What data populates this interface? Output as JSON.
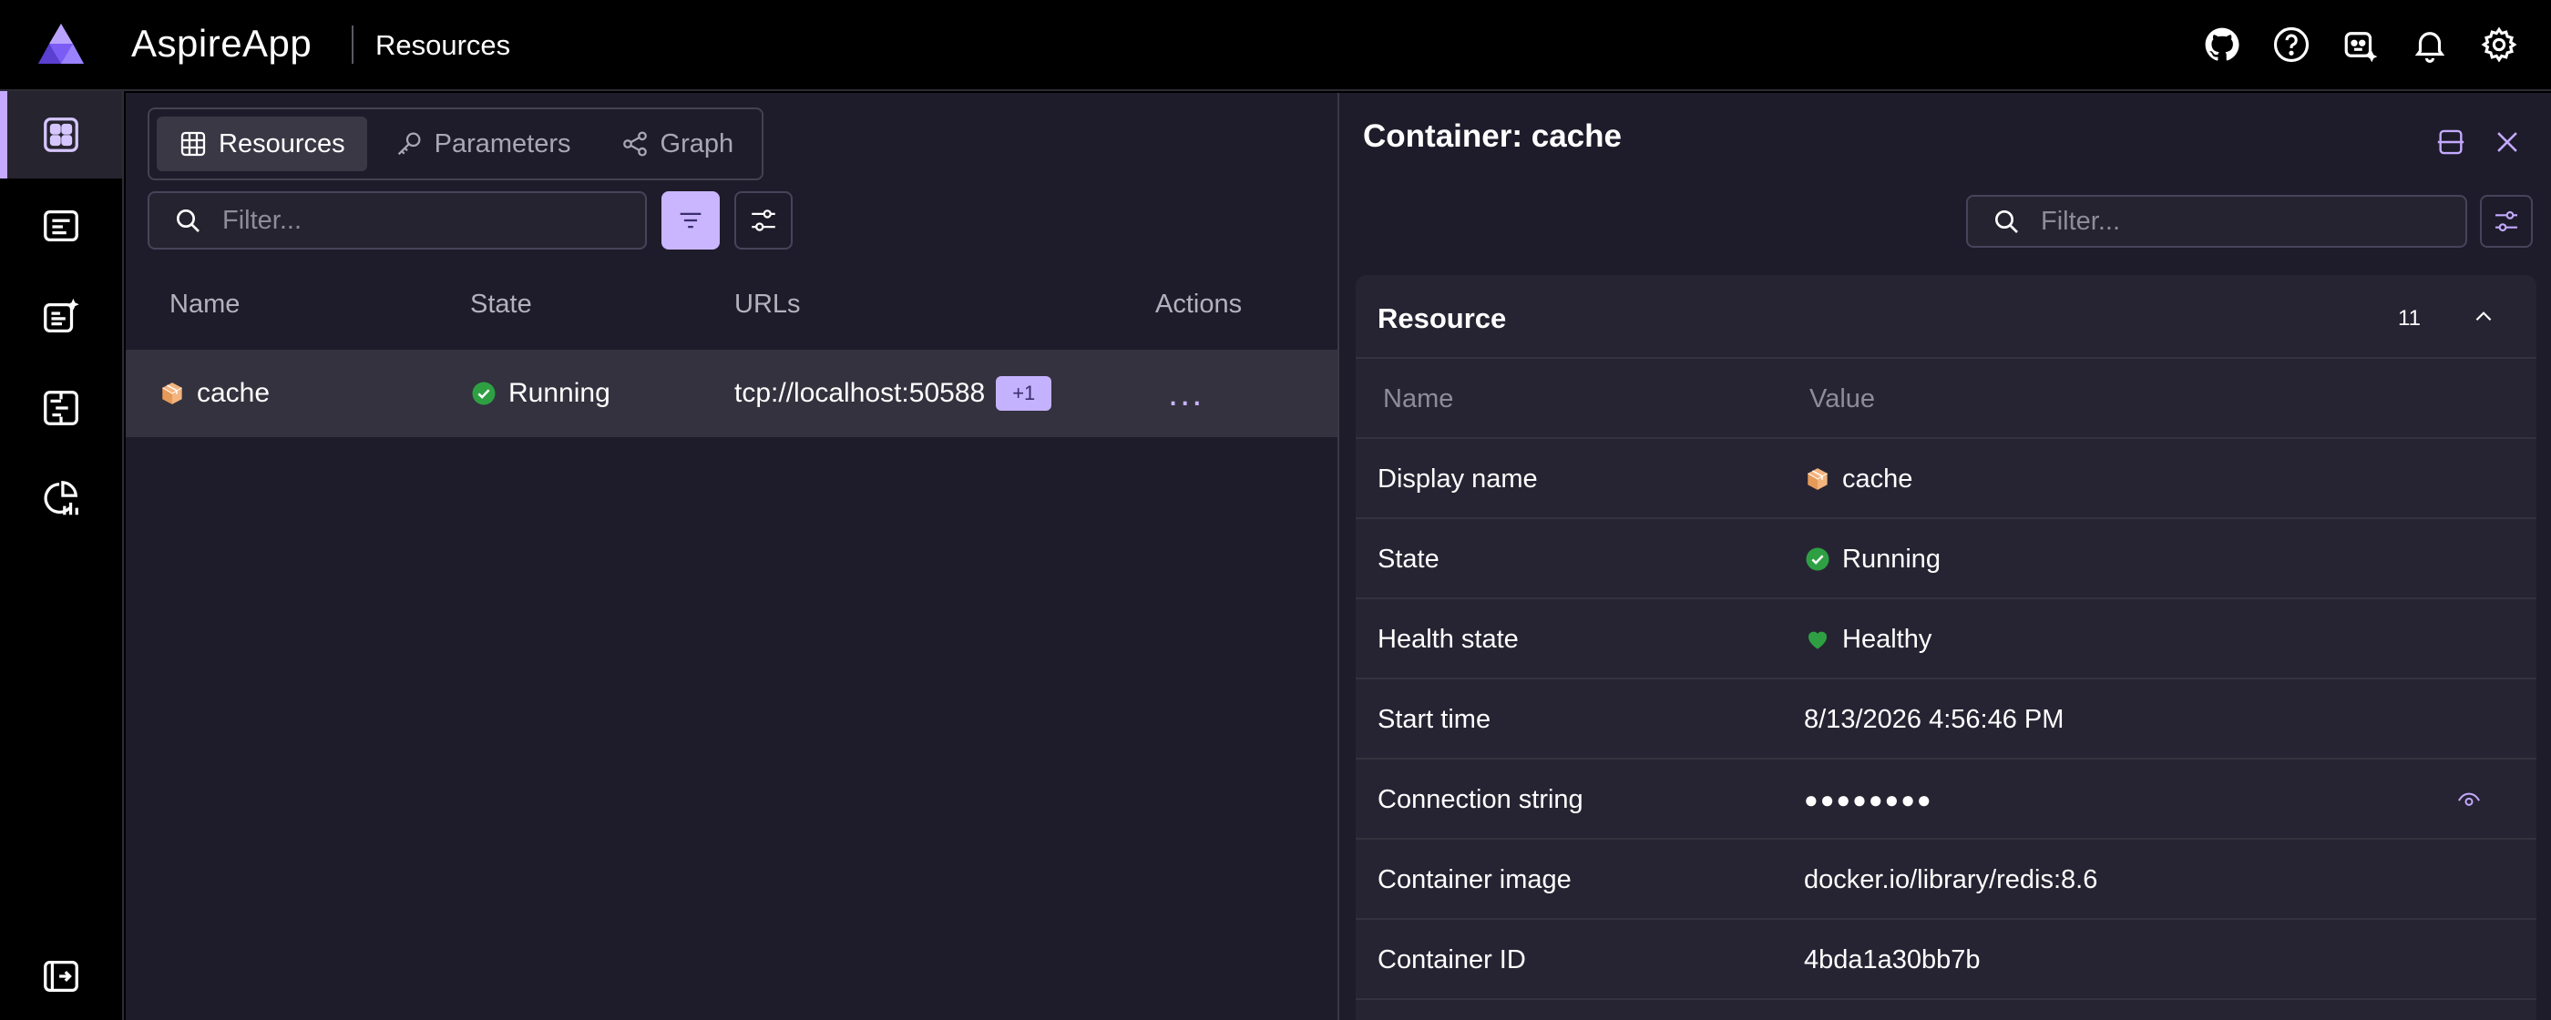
{
  "app": {
    "name": "AspireApp",
    "page_title": "Resources"
  },
  "top_icons": [
    "github-icon",
    "help-icon",
    "copilot-icon",
    "notification-bell-icon",
    "settings-gear-icon"
  ],
  "nav": {
    "items": [
      {
        "name": "resources",
        "active": true
      },
      {
        "name": "console-logs",
        "active": false
      },
      {
        "name": "structured-logs",
        "active": false
      },
      {
        "name": "traces",
        "active": false
      },
      {
        "name": "metrics",
        "active": false
      }
    ]
  },
  "tabs": [
    {
      "label": "Resources",
      "active": true
    },
    {
      "label": "Parameters",
      "active": false
    },
    {
      "label": "Graph",
      "active": false
    }
  ],
  "filter": {
    "placeholder": "Filter..."
  },
  "grid": {
    "headers": {
      "name": "Name",
      "state": "State",
      "urls": "URLs",
      "actions": "Actions"
    },
    "rows": [
      {
        "name": "cache",
        "state": "Running",
        "url": "tcp://localhost:50588",
        "url_extra": "+1",
        "actions": "..."
      }
    ]
  },
  "details": {
    "title": "Container: cache",
    "filter_placeholder": "Filter...",
    "section": {
      "title": "Resource",
      "count": "11",
      "col_name": "Name",
      "col_value": "Value",
      "rows": [
        {
          "name": "Display name",
          "value": "cache"
        },
        {
          "name": "State",
          "value": "Running"
        },
        {
          "name": "Health state",
          "value": "Healthy"
        },
        {
          "name": "Start time",
          "value": "8/13/2026 4:56:46 PM"
        },
        {
          "name": "Connection string",
          "value": "●●●●●●●●"
        },
        {
          "name": "Container image",
          "value": "docker.io/library/redis:8.6"
        },
        {
          "name": "Container ID",
          "value": "4bda1a30bb7b"
        }
      ]
    }
  },
  "colors": {
    "accent": "#c4a9ff",
    "running": "#2ea043",
    "healthy": "#2ea043",
    "package": "#f0b27a"
  }
}
